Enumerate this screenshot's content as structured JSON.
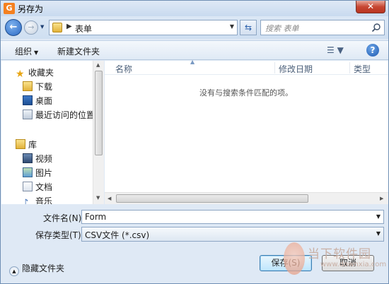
{
  "window": {
    "title": "另存为",
    "close_label": "✕"
  },
  "nav": {
    "address": "表单",
    "search_placeholder": "搜索 表单"
  },
  "toolbar": {
    "organize_label": "组织",
    "new_folder_label": "新建文件夹"
  },
  "sidebar": {
    "favorites_header": "收藏夹",
    "favorites": [
      {
        "label": "下载",
        "icon": "download-folder-icon"
      },
      {
        "label": "桌面",
        "icon": "desktop-icon"
      },
      {
        "label": "最近访问的位置",
        "icon": "recent-places-icon"
      }
    ],
    "libraries_header": "库",
    "libraries": [
      {
        "label": "视频",
        "icon": "video-library-icon"
      },
      {
        "label": "图片",
        "icon": "pictures-library-icon"
      },
      {
        "label": "文档",
        "icon": "documents-library-icon"
      },
      {
        "label": "音乐",
        "icon": "music-library-icon"
      }
    ]
  },
  "filelist": {
    "columns": [
      "名称",
      "修改日期",
      "类型"
    ],
    "empty_message": "没有与搜索条件匹配的项。"
  },
  "form": {
    "filename_label": "文件名(N):",
    "filename_value": "Form",
    "filetype_label": "保存类型(T):",
    "filetype_value": "CSV文件 (*.csv)",
    "hide_folders_label": "隐藏文件夹",
    "save_label": "保存(S)",
    "cancel_label": "取消"
  },
  "watermark": {
    "text": "当下软件园",
    "sub": "www.downxia.com"
  },
  "colors": {
    "accent": "#2a68c4",
    "window_bg": "#dfe9f5",
    "app_icon": "#f4801f",
    "close_red": "#c74733"
  }
}
